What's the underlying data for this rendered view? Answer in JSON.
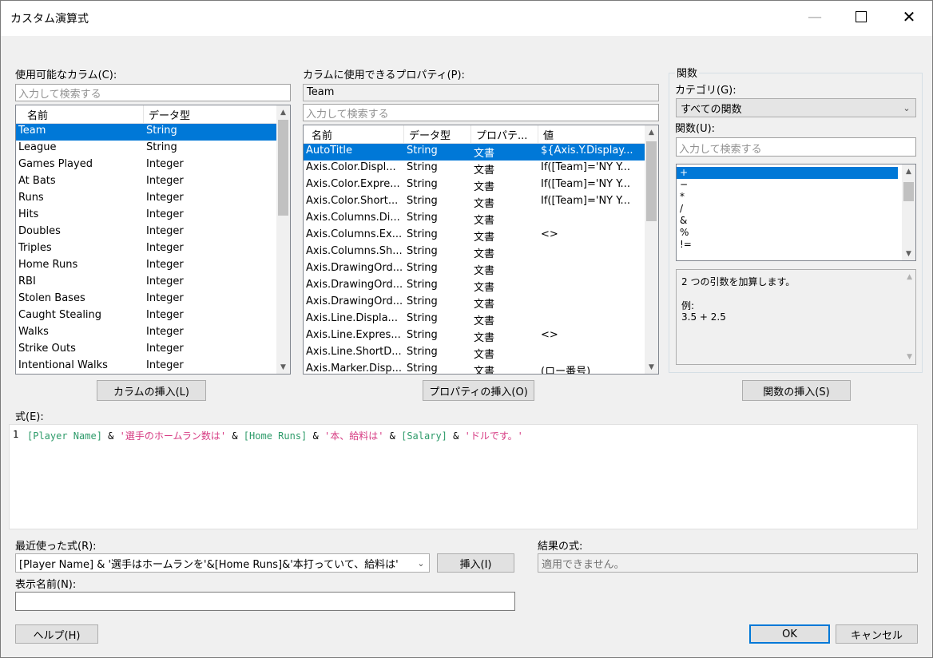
{
  "window": {
    "title": "カスタム演算式"
  },
  "colors": {
    "selection": "#0078d7",
    "code_column": "#2e9b6a",
    "code_string": "#d63a82",
    "code_operator": "#000000"
  },
  "columns_panel": {
    "label": "使用可能なカラム(C):",
    "search_placeholder": "入力して検索する",
    "headers": [
      "名前",
      "データ型"
    ],
    "rows": [
      [
        "Team",
        "String"
      ],
      [
        "League",
        "String"
      ],
      [
        "Games Played",
        "Integer"
      ],
      [
        "At Bats",
        "Integer"
      ],
      [
        "Runs",
        "Integer"
      ],
      [
        "Hits",
        "Integer"
      ],
      [
        "Doubles",
        "Integer"
      ],
      [
        "Triples",
        "Integer"
      ],
      [
        "Home Runs",
        "Integer"
      ],
      [
        "RBI",
        "Integer"
      ],
      [
        "Stolen Bases",
        "Integer"
      ],
      [
        "Caught Stealing",
        "Integer"
      ],
      [
        "Walks",
        "Integer"
      ],
      [
        "Strike Outs",
        "Integer"
      ],
      [
        "Intentional Walks",
        "Integer"
      ]
    ],
    "insert_button": "カラムの挿入(L)"
  },
  "properties_panel": {
    "label": "カラムに使用できるプロパティ(P):",
    "selected_column": "Team",
    "search_placeholder": "入力して検索する",
    "headers": [
      "名前",
      "データ型",
      "プロパテ...",
      "値"
    ],
    "rows": [
      [
        "AutoTitle",
        "String",
        "文書",
        "${Axis.Y.Display..."
      ],
      [
        "Axis.Color.Displ...",
        "String",
        "文書",
        "If([Team]='NY Y..."
      ],
      [
        "Axis.Color.Expre...",
        "String",
        "文書",
        "If([Team]='NY Y..."
      ],
      [
        "Axis.Color.Short...",
        "String",
        "文書",
        "If([Team]='NY Y..."
      ],
      [
        "Axis.Columns.Di...",
        "String",
        "文書",
        ""
      ],
      [
        "Axis.Columns.Ex...",
        "String",
        "文書",
        "<>"
      ],
      [
        "Axis.Columns.Sh...",
        "String",
        "文書",
        ""
      ],
      [
        "Axis.DrawingOrd...",
        "String",
        "文書",
        ""
      ],
      [
        "Axis.DrawingOrd...",
        "String",
        "文書",
        ""
      ],
      [
        "Axis.DrawingOrd...",
        "String",
        "文書",
        ""
      ],
      [
        "Axis.Line.Displa...",
        "String",
        "文書",
        ""
      ],
      [
        "Axis.Line.Expres...",
        "String",
        "文書",
        "<>"
      ],
      [
        "Axis.Line.ShortD...",
        "String",
        "文書",
        ""
      ],
      [
        "Axis.Marker.Disp...",
        "String",
        "文書",
        "(ロー番号)"
      ]
    ],
    "insert_button": "プロパティの挿入(O)"
  },
  "functions_panel": {
    "group_label": "関数",
    "category_label": "カテゴリ(G):",
    "category_value": "すべての関数",
    "function_label": "関数(U):",
    "search_placeholder": "入力して検索する",
    "items": [
      "+",
      "−",
      "*",
      "/",
      "&",
      "%",
      "!="
    ],
    "description": "2 つの引数を加算します。",
    "example_label": "例:",
    "example_value": "3.5 + 2.5",
    "insert_button": "関数の挿入(S)"
  },
  "expression": {
    "label": "式(E):",
    "line_number": "1",
    "tokens": [
      {
        "t": "[Player Name]",
        "k": "col"
      },
      {
        "t": " & ",
        "k": "op"
      },
      {
        "t": "'選手のホームラン数は'",
        "k": "str"
      },
      {
        "t": " & ",
        "k": "op"
      },
      {
        "t": "[Home Runs]",
        "k": "col"
      },
      {
        "t": " & ",
        "k": "op"
      },
      {
        "t": "'本、給料は'",
        "k": "str"
      },
      {
        "t": " & ",
        "k": "op"
      },
      {
        "t": "[Salary]",
        "k": "col"
      },
      {
        "t": " & ",
        "k": "op"
      },
      {
        "t": "'ドルです。'",
        "k": "str"
      }
    ]
  },
  "recent": {
    "label": "最近使った式(R):",
    "value": "[Player Name] & '選手はホームランを'&[Home Runs]&'本打っていて、給料は'",
    "insert_button": "挿入(I)"
  },
  "result": {
    "label": "結果の式:",
    "value": "適用できません。"
  },
  "display_name": {
    "label": "表示名前(N):",
    "value": ""
  },
  "footer": {
    "help": "ヘルプ(H)",
    "ok": "OK",
    "cancel": "キャンセル"
  }
}
